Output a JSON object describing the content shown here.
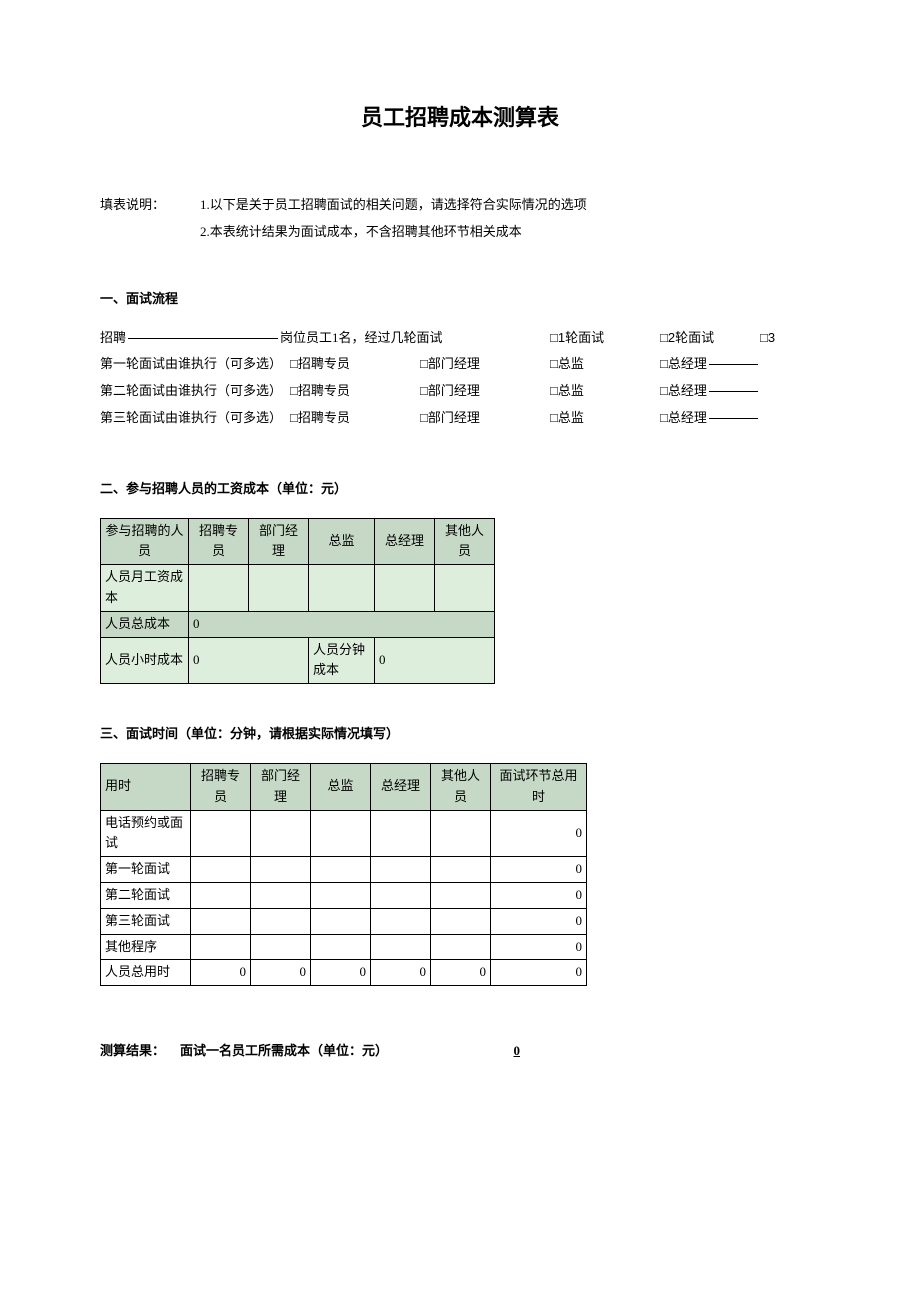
{
  "title": "员工招聘成本测算表",
  "instructions": {
    "label": "填表说明：",
    "line1": "1.以下是关于员工招聘面试的相关问题，请选择符合实际情况的选项",
    "line2": "2.本表统计结果为面试成本，不含招聘其他环节相关成本"
  },
  "section1": {
    "header": "一、面试流程",
    "row1": {
      "prefix": "招聘",
      "mid": "岗位员工1名，经过几轮面试",
      "opt1": "□1轮面试",
      "opt2": "□2轮面试",
      "opt3": "□3"
    },
    "row2": {
      "label": "第一轮面试由谁执行（可多选）",
      "opt1": "□招聘专员",
      "opt2": "□部门经理",
      "opt3": "□总监",
      "opt4": "□总经理"
    },
    "row3": {
      "label": "第二轮面试由谁执行（可多选）",
      "opt1": "□招聘专员",
      "opt2": "□部门经理",
      "opt3": "□总监",
      "opt4": "□总经理"
    },
    "row4": {
      "label": "第三轮面试由谁执行（可多选）",
      "opt1": "□招聘专员",
      "opt2": "□部门经理",
      "opt3": "□总监",
      "opt4": "□总经理"
    }
  },
  "section2": {
    "header": "二、参与招聘人员的工资成本（单位：元）",
    "cols": {
      "c0": "参与招聘的人员",
      "c1": "招聘专员",
      "c2": "部门经理",
      "c3": "总监",
      "c4": "总经理",
      "c5": "其他人员"
    },
    "rows": {
      "r1": "人员月工资成本",
      "r2": "人员总成本",
      "r2v": "0",
      "r3a": "人员小时成本",
      "r3av": "0",
      "r3b": "人员分钟成本",
      "r3bv": "0"
    }
  },
  "section3": {
    "header": "三、面试时间（单位：分钟，请根据实际情况填写）",
    "cols": {
      "c0": "用时",
      "c1": "招聘专员",
      "c2": "部门经理",
      "c3": "总监",
      "c4": "总经理",
      "c5": "其他人员",
      "c6": "面试环节总用时"
    },
    "rows": [
      {
        "label": "电话预约或面试",
        "c1": "",
        "c2": "",
        "c3": "",
        "c4": "",
        "c5": "",
        "total": "0"
      },
      {
        "label": "第一轮面试",
        "c1": "",
        "c2": "",
        "c3": "",
        "c4": "",
        "c5": "",
        "total": "0"
      },
      {
        "label": "第二轮面试",
        "c1": "",
        "c2": "",
        "c3": "",
        "c4": "",
        "c5": "",
        "total": "0"
      },
      {
        "label": "第三轮面试",
        "c1": "",
        "c2": "",
        "c3": "",
        "c4": "",
        "c5": "",
        "total": "0"
      },
      {
        "label": "其他程序",
        "c1": "",
        "c2": "",
        "c3": "",
        "c4": "",
        "c5": "",
        "total": "0"
      },
      {
        "label": "人员总用时",
        "c1": "0",
        "c2": "0",
        "c3": "0",
        "c4": "0",
        "c5": "0",
        "total": "0"
      }
    ]
  },
  "result": {
    "label": "测算结果：",
    "text": "面试一名员工所需成本（单位：元）",
    "value": "0"
  }
}
